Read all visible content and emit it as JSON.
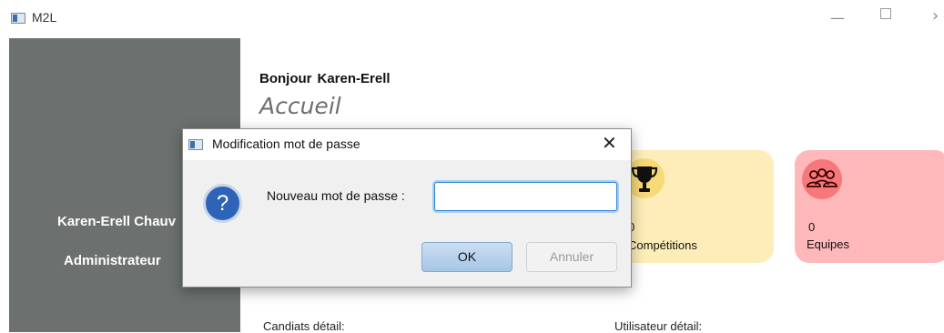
{
  "window": {
    "title": "M2L",
    "min_glyph": "—",
    "close_glyph": "›"
  },
  "sidebar": {
    "user_name": "Karen-Erell Chauv",
    "role": "Administrateur"
  },
  "main": {
    "greeting_prefix": "Bonjour",
    "greeting_name": "Karen-Erell",
    "page_title": "Accueil",
    "cards": [
      {
        "count": "0",
        "label": "Compétitions",
        "icon": "trophy-icon",
        "color": "#fdeeb9"
      },
      {
        "count": "0",
        "label": "Equipes",
        "icon": "group-icon",
        "color": "#ffb8ba"
      }
    ],
    "details": {
      "left": "Candiats détail:",
      "right": "Utilisateur détail:"
    }
  },
  "dialog": {
    "title": "Modification mot de passe",
    "close_glyph": "✕",
    "question_glyph": "?",
    "prompt": "Nouveau mot de passe :",
    "input_value": "",
    "ok_label": "OK",
    "cancel_label": "Annuler"
  }
}
